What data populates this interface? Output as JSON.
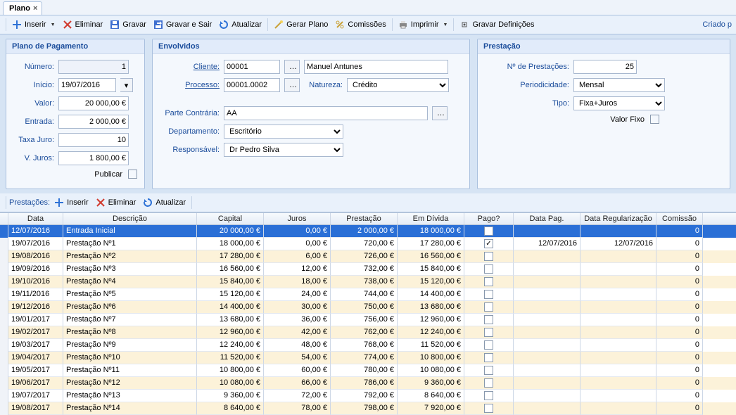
{
  "tab": {
    "title": "Plano"
  },
  "toolbar": {
    "inserir": "Inserir",
    "eliminar": "Eliminar",
    "gravar": "Gravar",
    "gravar_sair": "Gravar e Sair",
    "atualizar": "Atualizar",
    "gerar_plano": "Gerar Plano",
    "comissoes": "Comissões",
    "imprimir": "Imprimir",
    "gravar_def": "Gravar Definições",
    "criado": "Criado p"
  },
  "panel_pagamento": {
    "title": "Plano de Pagamento",
    "numero_label": "Número:",
    "numero": "1",
    "inicio_label": "Início:",
    "inicio": "19/07/2016",
    "valor_label": "Valor:",
    "valor": "20 000,00 €",
    "entrada_label": "Entrada:",
    "entrada": "2 000,00 €",
    "taxa_label": "Taxa Juro:",
    "taxa": "10",
    "vjuros_label": "V. Juros:",
    "vjuros": "1 800,00 €",
    "publicar_label": "Publicar"
  },
  "panel_envolvidos": {
    "title": "Envolvidos",
    "cliente_label": "Cliente:",
    "cliente_cod": "00001",
    "cliente_nome": "Manuel Antunes",
    "processo_label": "Processo:",
    "processo_cod": "00001.0002",
    "natureza_label": "Natureza:",
    "natureza": "Crédito",
    "parte_label": "Parte Contrária:",
    "parte": "AA",
    "dept_label": "Departamento:",
    "dept": "Escritório",
    "resp_label": "Responsável:",
    "resp": "Dr Pedro Silva"
  },
  "panel_prestacao": {
    "title": "Prestação",
    "nprest_label": "Nº de Prestações:",
    "nprest": "25",
    "period_label": "Periodicidade:",
    "period": "Mensal",
    "tipo_label": "Tipo:",
    "tipo": "Fixa+Juros",
    "valorfixo_label": "Valor Fixo"
  },
  "secbar": {
    "prestacoes": "Prestações:",
    "inserir": "Inserir",
    "eliminar": "Eliminar",
    "atualizar": "Atualizar"
  },
  "grid": {
    "headers": {
      "data": "Data",
      "descricao": "Descrição",
      "capital": "Capital",
      "juros": "Juros",
      "prestacao": "Prestação",
      "emdivida": "Em Dívida",
      "pago": "Pago?",
      "datapag": "Data Pag.",
      "datareg": "Data Regularização",
      "comissao": "Comissão"
    },
    "rows": [
      {
        "data": "12/07/2016",
        "desc": "Entrada Inicial",
        "cap": "20 000,00 €",
        "jur": "0,00 €",
        "prest": "2 000,00 €",
        "div": "18 000,00 €",
        "pago": true,
        "dpag": "",
        "dreg": "",
        "com": "0",
        "sel": true
      },
      {
        "data": "19/07/2016",
        "desc": "Prestação Nº1",
        "cap": "18 000,00 €",
        "jur": "0,00 €",
        "prest": "720,00 €",
        "div": "17 280,00 €",
        "pago": true,
        "dpag": "12/07/2016",
        "dreg": "12/07/2016",
        "com": "0"
      },
      {
        "data": "19/08/2016",
        "desc": "Prestação Nº2",
        "cap": "17 280,00 €",
        "jur": "6,00 €",
        "prest": "726,00 €",
        "div": "16 560,00 €",
        "pago": false,
        "dpag": "",
        "dreg": "",
        "com": "0"
      },
      {
        "data": "19/09/2016",
        "desc": "Prestação Nº3",
        "cap": "16 560,00 €",
        "jur": "12,00 €",
        "prest": "732,00 €",
        "div": "15 840,00 €",
        "pago": false,
        "dpag": "",
        "dreg": "",
        "com": "0"
      },
      {
        "data": "19/10/2016",
        "desc": "Prestação Nº4",
        "cap": "15 840,00 €",
        "jur": "18,00 €",
        "prest": "738,00 €",
        "div": "15 120,00 €",
        "pago": false,
        "dpag": "",
        "dreg": "",
        "com": "0"
      },
      {
        "data": "19/11/2016",
        "desc": "Prestação Nº5",
        "cap": "15 120,00 €",
        "jur": "24,00 €",
        "prest": "744,00 €",
        "div": "14 400,00 €",
        "pago": false,
        "dpag": "",
        "dreg": "",
        "com": "0"
      },
      {
        "data": "19/12/2016",
        "desc": "Prestação Nº6",
        "cap": "14 400,00 €",
        "jur": "30,00 €",
        "prest": "750,00 €",
        "div": "13 680,00 €",
        "pago": false,
        "dpag": "",
        "dreg": "",
        "com": "0"
      },
      {
        "data": "19/01/2017",
        "desc": "Prestação Nº7",
        "cap": "13 680,00 €",
        "jur": "36,00 €",
        "prest": "756,00 €",
        "div": "12 960,00 €",
        "pago": false,
        "dpag": "",
        "dreg": "",
        "com": "0"
      },
      {
        "data": "19/02/2017",
        "desc": "Prestação Nº8",
        "cap": "12 960,00 €",
        "jur": "42,00 €",
        "prest": "762,00 €",
        "div": "12 240,00 €",
        "pago": false,
        "dpag": "",
        "dreg": "",
        "com": "0"
      },
      {
        "data": "19/03/2017",
        "desc": "Prestação Nº9",
        "cap": "12 240,00 €",
        "jur": "48,00 €",
        "prest": "768,00 €",
        "div": "11 520,00 €",
        "pago": false,
        "dpag": "",
        "dreg": "",
        "com": "0"
      },
      {
        "data": "19/04/2017",
        "desc": "Prestação Nº10",
        "cap": "11 520,00 €",
        "jur": "54,00 €",
        "prest": "774,00 €",
        "div": "10 800,00 €",
        "pago": false,
        "dpag": "",
        "dreg": "",
        "com": "0"
      },
      {
        "data": "19/05/2017",
        "desc": "Prestação Nº11",
        "cap": "10 800,00 €",
        "jur": "60,00 €",
        "prest": "780,00 €",
        "div": "10 080,00 €",
        "pago": false,
        "dpag": "",
        "dreg": "",
        "com": "0"
      },
      {
        "data": "19/06/2017",
        "desc": "Prestação Nº12",
        "cap": "10 080,00 €",
        "jur": "66,00 €",
        "prest": "786,00 €",
        "div": "9 360,00 €",
        "pago": false,
        "dpag": "",
        "dreg": "",
        "com": "0"
      },
      {
        "data": "19/07/2017",
        "desc": "Prestação Nº13",
        "cap": "9 360,00 €",
        "jur": "72,00 €",
        "prest": "792,00 €",
        "div": "8 640,00 €",
        "pago": false,
        "dpag": "",
        "dreg": "",
        "com": "0"
      },
      {
        "data": "19/08/2017",
        "desc": "Prestação Nº14",
        "cap": "8 640,00 €",
        "jur": "78,00 €",
        "prest": "798,00 €",
        "div": "7 920,00 €",
        "pago": false,
        "dpag": "",
        "dreg": "",
        "com": "0"
      }
    ]
  }
}
